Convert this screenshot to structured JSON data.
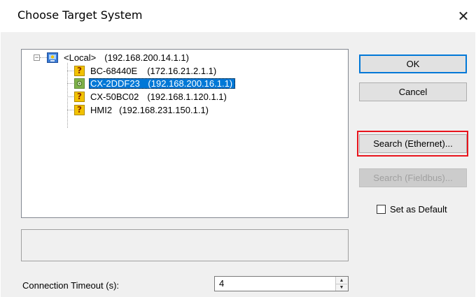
{
  "dialog": {
    "title": "Choose Target System",
    "close_glyph": "✕"
  },
  "tree": {
    "root": {
      "name": "<Local>",
      "address": "(192.168.200.14.1.1)",
      "expander": "−",
      "icon": "local-system-icon"
    },
    "children": [
      {
        "name": "BC-68440E",
        "address": "(172.16.21.2.1.1)",
        "icon": "unknown-device-icon",
        "selected": false
      },
      {
        "name": "CX-2DDF23",
        "address": "(192.168.200.16.1.1)",
        "icon": "connected-device-icon",
        "selected": true
      },
      {
        "name": "CX-50BC02",
        "address": "(192.168.1.120.1.1)",
        "icon": "unknown-device-icon",
        "selected": false
      },
      {
        "name": "HMI2",
        "address": "(192.168.231.150.1.1)",
        "icon": "unknown-device-icon",
        "selected": false
      }
    ]
  },
  "buttons": {
    "ok": "OK",
    "cancel": "Cancel",
    "search_ethernet": "Search (Ethernet)...",
    "search_fieldbus": "Search (Fieldbus)..."
  },
  "set_as_default": {
    "label": "Set as Default",
    "checked": false
  },
  "timeout": {
    "label": "Connection Timeout (s):",
    "value": "4"
  },
  "colors": {
    "selection": "#0078d7",
    "highlight": "#e8141c"
  }
}
